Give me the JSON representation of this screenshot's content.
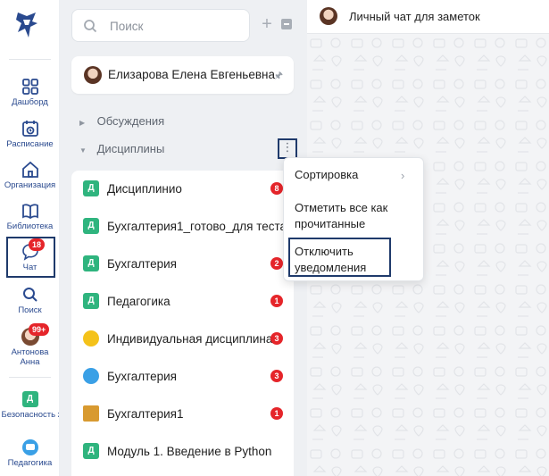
{
  "rail": {
    "items": [
      {
        "label": "Дашборд",
        "icon": "dashboard-grid-icon"
      },
      {
        "label": "Расписание",
        "icon": "calendar-clock-icon"
      },
      {
        "label": "Организация",
        "icon": "organization-house-icon"
      },
      {
        "label": "Библиотека",
        "icon": "open-book-icon"
      },
      {
        "label": "Чат",
        "icon": "chat-bubble-icon",
        "badge": "18"
      },
      {
        "label": "Поиск",
        "icon": "search-icon"
      },
      {
        "label": "Антонова Анна",
        "icon": "user-avatar",
        "badge": "99+"
      },
      {
        "label": "Безопасность ж",
        "icon": "discipline-d-tile",
        "tile": "Д"
      },
      {
        "label": "Педагогика",
        "icon": "chat-group-icon"
      }
    ]
  },
  "search": {
    "placeholder": "Поиск"
  },
  "pinned": {
    "name": "Елизарова Елена Евгеньевна"
  },
  "sections": {
    "discussions": "Обсуждения",
    "disciplines": "Дисциплины"
  },
  "chats": [
    {
      "name": "Дисциплинио",
      "icon": "d",
      "tile": "Д",
      "badge": "8"
    },
    {
      "name": "Бухгалтерия1_готово_для теста",
      "icon": "d",
      "tile": "Д",
      "badge": ""
    },
    {
      "name": "Бухгалтерия",
      "icon": "d",
      "tile": "Д",
      "badge": "2"
    },
    {
      "name": "Педагогика",
      "icon": "d",
      "tile": "Д",
      "badge": "1"
    },
    {
      "name": "Индивидуальная дисциплина",
      "icon": "bot",
      "tile": "",
      "badge": "3"
    },
    {
      "name": "Бухгалтерия",
      "icon": "chat",
      "tile": "",
      "badge": "3"
    },
    {
      "name": "Бухгалтерия1",
      "icon": "grad",
      "tile": "",
      "badge": "1"
    },
    {
      "name": "Модуль 1. Введение в Python",
      "icon": "d",
      "tile": "Д",
      "badge": ""
    }
  ],
  "menu": {
    "sort": "Сортировка",
    "mark_read_1": "Отметить все как",
    "mark_read_2": "прочитанные",
    "mute_1": "Отключить",
    "mute_2": "уведомления"
  },
  "chat_header": {
    "title": "Личный чат для заметок"
  },
  "colors": {
    "accent": "#2a4a8f",
    "badge": "#e5252a",
    "discipline_tile": "#2fb47e",
    "highlight_box": "#1f3a6b"
  }
}
